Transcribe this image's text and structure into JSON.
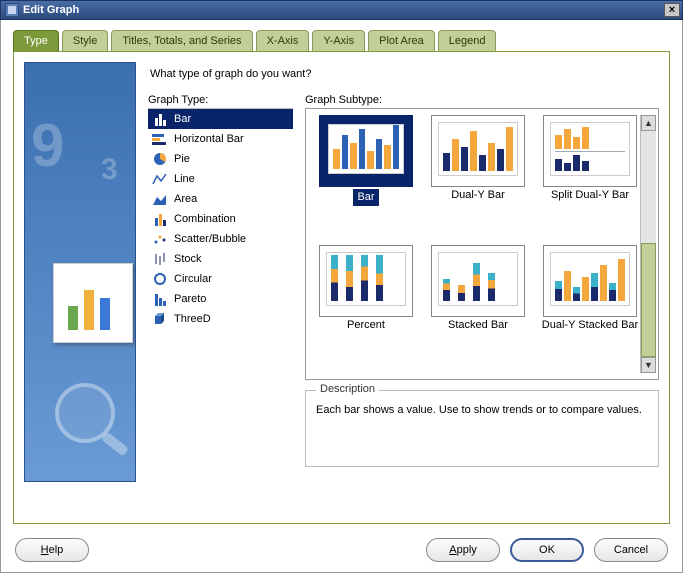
{
  "window": {
    "title": "Edit Graph"
  },
  "tabs": [
    {
      "label": "Type",
      "active": true
    },
    {
      "label": "Style",
      "active": false
    },
    {
      "label": "Titles, Totals, and Series",
      "active": false
    },
    {
      "label": "X-Axis",
      "active": false
    },
    {
      "label": "Y-Axis",
      "active": false
    },
    {
      "label": "Plot Area",
      "active": false
    },
    {
      "label": "Legend",
      "active": false
    }
  ],
  "prompt": "What type of graph do you want?",
  "graphType": {
    "label": "Graph Type:",
    "items": [
      {
        "name": "Bar",
        "icon": "bar-icon",
        "selected": true
      },
      {
        "name": "Horizontal Bar",
        "icon": "horizontal-bar-icon",
        "selected": false
      },
      {
        "name": "Pie",
        "icon": "pie-icon",
        "selected": false
      },
      {
        "name": "Line",
        "icon": "line-icon",
        "selected": false
      },
      {
        "name": "Area",
        "icon": "area-icon",
        "selected": false
      },
      {
        "name": "Combination",
        "icon": "combination-icon",
        "selected": false
      },
      {
        "name": "Scatter/Bubble",
        "icon": "scatter-icon",
        "selected": false
      },
      {
        "name": "Stock",
        "icon": "stock-icon",
        "selected": false
      },
      {
        "name": "Circular",
        "icon": "circular-icon",
        "selected": false
      },
      {
        "name": "Pareto",
        "icon": "pareto-icon",
        "selected": false
      },
      {
        "name": "ThreeD",
        "icon": "threed-icon",
        "selected": false
      }
    ]
  },
  "graphSubtype": {
    "label": "Graph Subtype:",
    "items": [
      {
        "name": "Bar",
        "selected": true
      },
      {
        "name": "Dual-Y Bar",
        "selected": false
      },
      {
        "name": "Split Dual-Y Bar",
        "selected": false
      },
      {
        "name": "Percent",
        "selected": false
      },
      {
        "name": "Stacked Bar",
        "selected": false
      },
      {
        "name": "Dual-Y Stacked Bar",
        "selected": false
      }
    ]
  },
  "description": {
    "legend": "Description",
    "text": "Each bar shows a value. Use to show trends or to compare values."
  },
  "buttons": {
    "help": "Help",
    "apply": "Apply",
    "ok": "OK",
    "cancel": "Cancel"
  }
}
